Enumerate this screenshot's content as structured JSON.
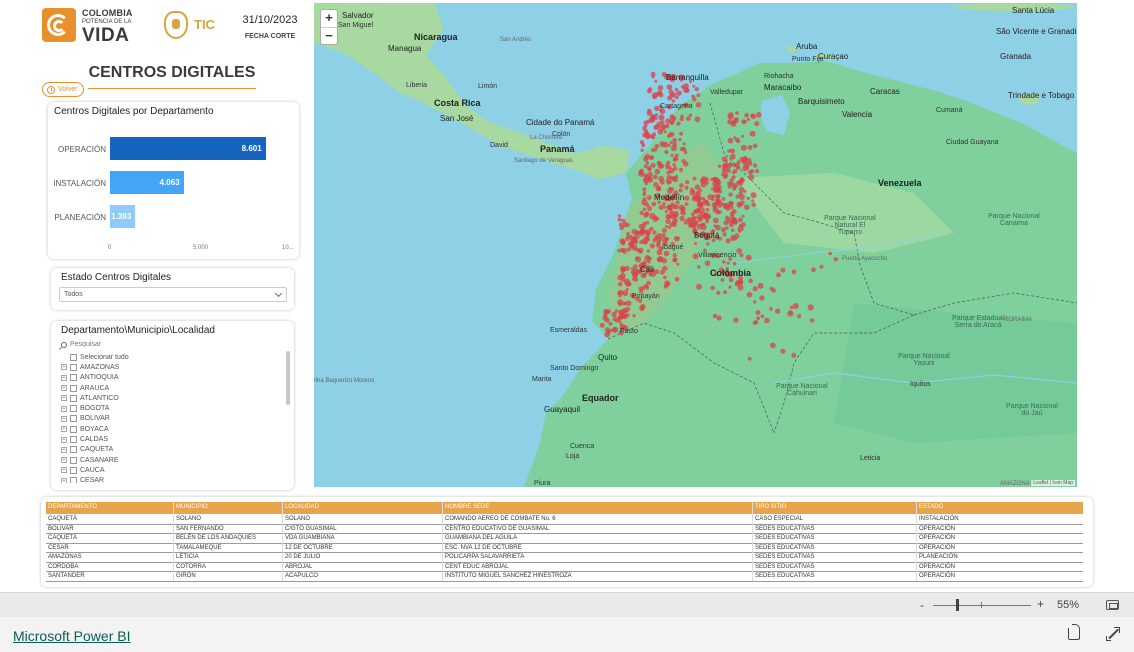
{
  "header": {
    "brand_line1": "COLOMBIA",
    "brand_line2": "POTENCIA DE LA",
    "brand_line3": "VIDA",
    "tic": "TIC",
    "date": "31/10/2023",
    "date_label": "FECHA CORTE",
    "title": "CENTROS DIGITALES",
    "back_label": "Volver"
  },
  "colors": {
    "accent": "#e8902a",
    "bar_operacion": "#1565c0",
    "bar_instalacion": "#42a5f5",
    "bar_planeacion": "#90caf9",
    "table_header": "#e8a44b"
  },
  "bar_card": {
    "title": "Centros Digitales por Departamento",
    "axis_ticks": [
      "0",
      "5.000",
      "10..."
    ]
  },
  "chart_data": {
    "type": "bar",
    "orientation": "horizontal",
    "categories": [
      "OPERACIÓN",
      "INSTALACIÓN",
      "PLANEACIÓN"
    ],
    "values": [
      8601,
      4063,
      1393
    ],
    "value_labels": [
      "8.601",
      "4.063",
      "1.393"
    ],
    "xlim": [
      0,
      10000
    ]
  },
  "estado_slicer": {
    "title": "Estado Centros Digitales",
    "selected": "Todos"
  },
  "dept_slicer": {
    "title": "Departamento\\Municipio\\Localidad",
    "search_placeholder": "Pesquisar",
    "select_all": "Selecionar tudo",
    "items": [
      "AMAZONAS",
      "ANTIOQUIA",
      "ARAUCA",
      "ATLANTICO",
      "BOGOTA",
      "BOLIVAR",
      "BOYACA",
      "CALDAS",
      "CAQUETA",
      "CASANARE",
      "CAUCA",
      "CESAR"
    ]
  },
  "map": {
    "zoom_in": "+",
    "zoom_out": "−",
    "attribution": "Leaflet | Icon Map",
    "labels": [
      {
        "t": "Salvador",
        "c": "med"
      },
      {
        "t": "San Miguel",
        "c": ""
      },
      {
        "t": "Managua",
        "c": "med"
      },
      {
        "t": "Nicaragua",
        "c": "big"
      },
      {
        "t": "San Andrés",
        "c": "gray"
      },
      {
        "t": "Liberia",
        "c": ""
      },
      {
        "t": "Costa Rica",
        "c": "big"
      },
      {
        "t": "San José",
        "c": "med"
      },
      {
        "t": "Limón",
        "c": ""
      },
      {
        "t": "Cidade do Panamá",
        "c": "med"
      },
      {
        "t": "Panamá",
        "c": "big"
      },
      {
        "t": "David",
        "c": ""
      },
      {
        "t": "Santiago de Veraguas",
        "c": "gray"
      },
      {
        "t": "La Chorrera",
        "c": "gray"
      },
      {
        "t": "Colón",
        "c": ""
      },
      {
        "t": "Barranquilla",
        "c": "med"
      },
      {
        "t": "Cartagena",
        "c": ""
      },
      {
        "t": "Valledupar",
        "c": ""
      },
      {
        "t": "Riohacha",
        "c": ""
      },
      {
        "t": "Aruba",
        "c": "med"
      },
      {
        "t": "Curaçao",
        "c": "med"
      },
      {
        "t": "Punto Fijo",
        "c": ""
      },
      {
        "t": "Santa Lúcia",
        "c": "med"
      },
      {
        "t": "São Vicente e Granadinas",
        "c": "med"
      },
      {
        "t": "Granada",
        "c": "med"
      },
      {
        "t": "Trindade e Tobago",
        "c": "med"
      },
      {
        "t": "Maracaibo",
        "c": "med"
      },
      {
        "t": "Barquisimeto",
        "c": "med"
      },
      {
        "t": "Valencia",
        "c": "med"
      },
      {
        "t": "Caracas",
        "c": "med"
      },
      {
        "t": "Cumaná",
        "c": ""
      },
      {
        "t": "Ciudad Guayana",
        "c": ""
      },
      {
        "t": "Venezuela",
        "c": "big"
      },
      {
        "t": "Medellín",
        "c": "med"
      },
      {
        "t": "Bogotá",
        "c": "med"
      },
      {
        "t": "Cali",
        "c": "med"
      },
      {
        "t": "Colômbia",
        "c": "big"
      },
      {
        "t": "Villavicencio",
        "c": ""
      },
      {
        "t": "Popayán",
        "c": ""
      },
      {
        "t": "Pasto",
        "c": ""
      },
      {
        "t": "Ibagué",
        "c": ""
      },
      {
        "t": "Parque Nacional Natural El Tuparro",
        "c": "park"
      },
      {
        "t": "Puerto Ayacucho",
        "c": "gray"
      },
      {
        "t": "Parque Nacional Canaima",
        "c": "park"
      },
      {
        "t": "Esmeraldas",
        "c": ""
      },
      {
        "t": "Quito",
        "c": "med"
      },
      {
        "t": "Santo Domingo",
        "c": ""
      },
      {
        "t": "Manta",
        "c": ""
      },
      {
        "t": "Guayaquil",
        "c": "med"
      },
      {
        "t": "Equador",
        "c": "big"
      },
      {
        "t": "Cuenca",
        "c": ""
      },
      {
        "t": "Loja",
        "c": ""
      },
      {
        "t": "Piura",
        "c": ""
      },
      {
        "t": "Parque Nacional Cahuinari",
        "c": "park"
      },
      {
        "t": "Parque Nacional do Jaú",
        "c": "park"
      },
      {
        "t": "Parque Estadual Serra do Aracá",
        "c": "park"
      },
      {
        "t": "RORAIMA",
        "c": "gray"
      },
      {
        "t": "AMAZONAS",
        "c": "gray"
      },
      {
        "t": "Leticia",
        "c": ""
      },
      {
        "t": "Iquitos",
        "c": ""
      },
      {
        "t": "Parque Nacional Yasuni",
        "c": "park"
      },
      {
        "t": "Ilha Baquerizo Moreno",
        "c": "gray"
      }
    ]
  },
  "table": {
    "headers": [
      "DEPARTAMENTO",
      "MUNICIPIO",
      "LOCALIDAD",
      "NOMBRE SEDE",
      "TIPO SITIO",
      "ESTADO"
    ],
    "rows": [
      [
        "CAQUETÁ",
        "SOLANO",
        "SOLANO",
        "COMANDO AEREO DE COMBATE No. 6",
        "CASO ESPECIAL",
        "INSTALACIÓN"
      ],
      [
        "BOLIVAR",
        "SAN FERNANDO",
        "C/GTO GUASIMAL",
        "CENTRO EDUCATIVO DE GUASIMAL",
        "SEDES EDUCATIVAS",
        "OPERACIÓN"
      ],
      [
        "CAQUETÁ",
        "BELÉN DE LOS ANDAQUIES",
        "VDA GUAMBIANA",
        "GUAMBIANA DEL AGUILA",
        "SEDES EDUCATIVAS",
        "OPERACIÓN"
      ],
      [
        "CESAR",
        "TAMALAMEQUE",
        "12 DE OCTUBRE",
        "ESC. NVA 12 DE OCTUBRE",
        "SEDES EDUCATIVAS",
        "OPERACIÓN"
      ],
      [
        "AMAZONAS",
        "LETICIA",
        "20 DE JULIO",
        "POLICARPA SALAVARRIETA",
        "SEDES EDUCATIVAS",
        "PLANEACIÓN"
      ],
      [
        "CORDOBA",
        "COTORRA",
        "ABROJAL",
        "CENT EDUC ABROJAL",
        "SEDES EDUCATIVAS",
        "OPERACIÓN"
      ],
      [
        "SANTANDER",
        "GIRÓN",
        "ACAPULCO",
        "INSTITUTO MIGUEL SANCHEZ HINESTROZA",
        "SEDES EDUCATIVAS",
        "OPERACIÓN"
      ]
    ]
  },
  "status_bar": {
    "zoom_minus": "-",
    "zoom_plus": "+",
    "zoom_level": 55,
    "zoom_pct": "55%"
  },
  "footer": {
    "link": "Microsoft Power BI"
  }
}
